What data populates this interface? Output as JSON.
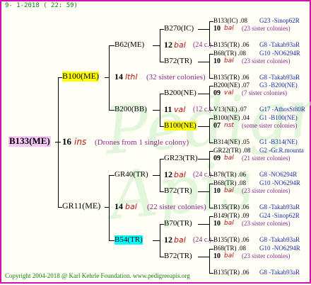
{
  "date": "9- 1-2018 ( 22: 59)",
  "watermark": "Pedigree Apis",
  "copyright": "Copyright 2004-2018 @ Karl Kehrle Foundation.   www.pedigreeapis.org",
  "root": {
    "name": "B133(ME)",
    "num": "16",
    "loc": "ins",
    "note": "(Drones from 1 single colony)"
  },
  "colors": {
    "border": "#d010b0",
    "highlight_yellow": "#ffff00",
    "highlight_cyan": "#00ffff"
  },
  "g1": [
    {
      "name": "B100(ME)",
      "num": "14",
      "loc": "lthl",
      "note": "(32 sister colonies)"
    },
    {
      "name": "GR11(ME)",
      "num": "14",
      "loc": "bal",
      "note": "(22 sister colonies)"
    }
  ],
  "g2": [
    {
      "name": "B62(ME)",
      "num": "12",
      "loc": "bal",
      "note": "(24 c.)"
    },
    {
      "name": "B200(BB)",
      "num": "11",
      "loc": "val",
      "note": "(12 c.)"
    },
    {
      "name": "GR40(TR)",
      "num": "12",
      "loc": "bal",
      "note": "(24 c.)"
    },
    {
      "name": "B54(TR)",
      "num": "12",
      "loc": "bal",
      "note": "(24 c.)"
    }
  ],
  "g3": [
    "B270(IC)",
    "B72(TR)",
    "B200(NE)",
    "B100(NE)",
    "GR23(TR)",
    "B72(TR)",
    "B70(TR)",
    "B72(TR)"
  ],
  "g4": [
    {
      "top": "B133(IC) .08",
      "topx": "G23 -Sinop62R",
      "num": "10",
      "loc": "bal",
      "note": "(23 sister colonies)",
      "bot": "B135(TR) .06",
      "botx": "G8 -Takab93aR"
    },
    {
      "top": "B68(TR) .08",
      "topx": "G10 -NO6294R",
      "num": "10",
      "loc": "bal",
      "note": "(23 sister colonies)",
      "bot": "B135(TR) .06",
      "botx": "G8 -Takab93aR"
    },
    {
      "top": "B200(NE) .07",
      "topx": "G3 -B200(NE)",
      "num": "09",
      "loc": "val",
      "note": "(7 sister colonies)",
      "bot": "V13(NE) .07",
      "botx": "G17 -AthosSt80R"
    },
    {
      "top": "B100(NE) .04",
      "topx": "G1 -B100(NE)",
      "num": "07",
      "loc": "nst",
      "note": "(some sister colonies)",
      "bot": "B314(NE) .05",
      "botx": "G1 -B314(NE)"
    },
    {
      "top": "GR22(TR) .08",
      "topx": "G2 -Gr.R.mounta",
      "num": "09",
      "loc": "bal",
      "note": "(21 sister colonies)",
      "bot": "B78(TR) .06",
      "botx": "G8 -NO6294R"
    },
    {
      "top": "B68(TR) .08",
      "topx": "G10 -NO6294R",
      "num": "10",
      "loc": "bal",
      "note": "(23 sister colonies)",
      "bot": "B135(TR) .06",
      "botx": "G8 -Takab93aR"
    },
    {
      "top": "B149(TR) .09",
      "topx": "G24 -Sinop62R",
      "num": "10",
      "loc": "bal",
      "note": "(23 sister colonies)",
      "bot": "B135(TR) .06",
      "botx": "G8 -Takab93aR"
    },
    {
      "top": "B68(TR) .08",
      "topx": "G10 -NO6294R",
      "num": "10",
      "loc": "bal",
      "note": "(23 sister colonies)",
      "bot": "B135(TR) .06",
      "botx": "G8 -Takab93aR"
    }
  ]
}
